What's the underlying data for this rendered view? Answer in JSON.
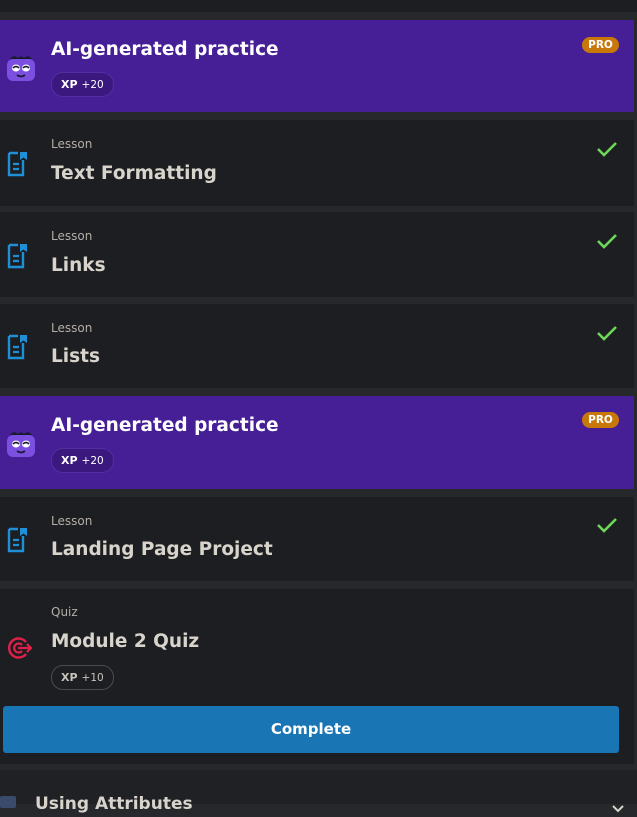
{
  "items": [
    {
      "type": "practice",
      "title": "AI-generated practice",
      "badge": "PRO",
      "xp_label": "XP",
      "xp_amount": "+20"
    },
    {
      "type": "lesson",
      "kind": "Lesson",
      "title": "Text Formatting",
      "completed": true
    },
    {
      "type": "lesson",
      "kind": "Lesson",
      "title": "Links",
      "completed": true
    },
    {
      "type": "lesson",
      "kind": "Lesson",
      "title": "Lists",
      "completed": true
    },
    {
      "type": "practice",
      "title": "AI-generated practice",
      "badge": "PRO",
      "xp_label": "XP",
      "xp_amount": "+20"
    },
    {
      "type": "lesson",
      "kind": "Lesson",
      "title": "Landing Page Project",
      "completed": true
    },
    {
      "type": "quiz",
      "kind": "Quiz",
      "title": "Module 2 Quiz",
      "xp_label": "XP",
      "xp_amount": "+10"
    }
  ],
  "complete_button": {
    "label": "Complete"
  },
  "next_section": {
    "title": "Using Attributes"
  },
  "colors": {
    "background": "#26282c",
    "card": "#1d1e21",
    "pro_card": "#461e96",
    "pro_badge": "#c8780a",
    "lesson_icon": "#1e90d8",
    "check": "#6bd85a",
    "quiz_icon": "#e0204a",
    "button": "#1a75b5"
  },
  "icons": {
    "practice": "robot-mascot-icon",
    "lesson": "lesson-document-icon",
    "quiz": "target-icon",
    "completed": "check-icon",
    "next_section": "chevron-down-icon"
  }
}
